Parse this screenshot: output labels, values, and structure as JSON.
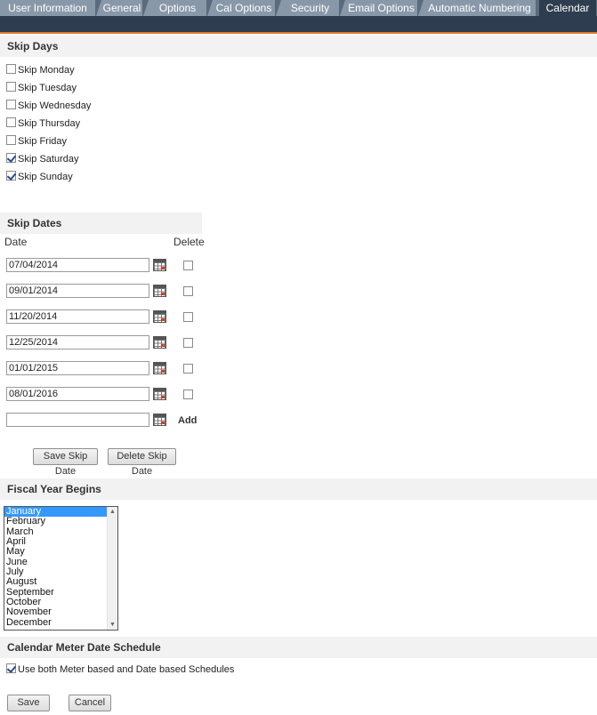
{
  "tabs": [
    {
      "label": "User Information",
      "active": false
    },
    {
      "label": "General",
      "active": false
    },
    {
      "label": "Options",
      "active": false
    },
    {
      "label": "Cal Options",
      "active": false
    },
    {
      "label": "Security",
      "active": false
    },
    {
      "label": "Email Options",
      "active": false
    },
    {
      "label": "Automatic Numbering",
      "active": false
    },
    {
      "label": "Calendar",
      "active": true
    }
  ],
  "skip_days": {
    "title": "Skip Days",
    "items": [
      {
        "label": "Skip Monday",
        "checked": false
      },
      {
        "label": "Skip Tuesday",
        "checked": false
      },
      {
        "label": "Skip Wednesday",
        "checked": false
      },
      {
        "label": "Skip Thursday",
        "checked": false
      },
      {
        "label": "Skip Friday",
        "checked": false
      },
      {
        "label": "Skip Saturday",
        "checked": true
      },
      {
        "label": "Skip Sunday",
        "checked": true
      }
    ]
  },
  "skip_dates": {
    "title": "Skip Dates",
    "col_date": "Date",
    "col_delete": "Delete",
    "dates": [
      "07/04/2014",
      "09/01/2014",
      "11/20/2014",
      "12/25/2014",
      "01/01/2015",
      "08/01/2016"
    ],
    "new_date": "",
    "add_label": "Add",
    "save_button": "Save Skip Date",
    "delete_button": "Delete Skip Date"
  },
  "fiscal_year": {
    "title": "Fiscal Year Begins",
    "months": [
      "January",
      "February",
      "March",
      "April",
      "May",
      "June",
      "July",
      "August",
      "September",
      "October",
      "November",
      "December"
    ],
    "selected": "January"
  },
  "meter_schedule": {
    "title": "Calendar Meter Date Schedule",
    "checkbox_label": "Use both Meter based and Date based Schedules",
    "checked": true
  },
  "footer": {
    "save_label": "Save",
    "cancel_label": "Cancel"
  },
  "colors": {
    "tab_bar": "#2e3d4f",
    "tab": "#8898a9",
    "accent_line": "#e07a2e",
    "list_selection": "#3399ff"
  }
}
